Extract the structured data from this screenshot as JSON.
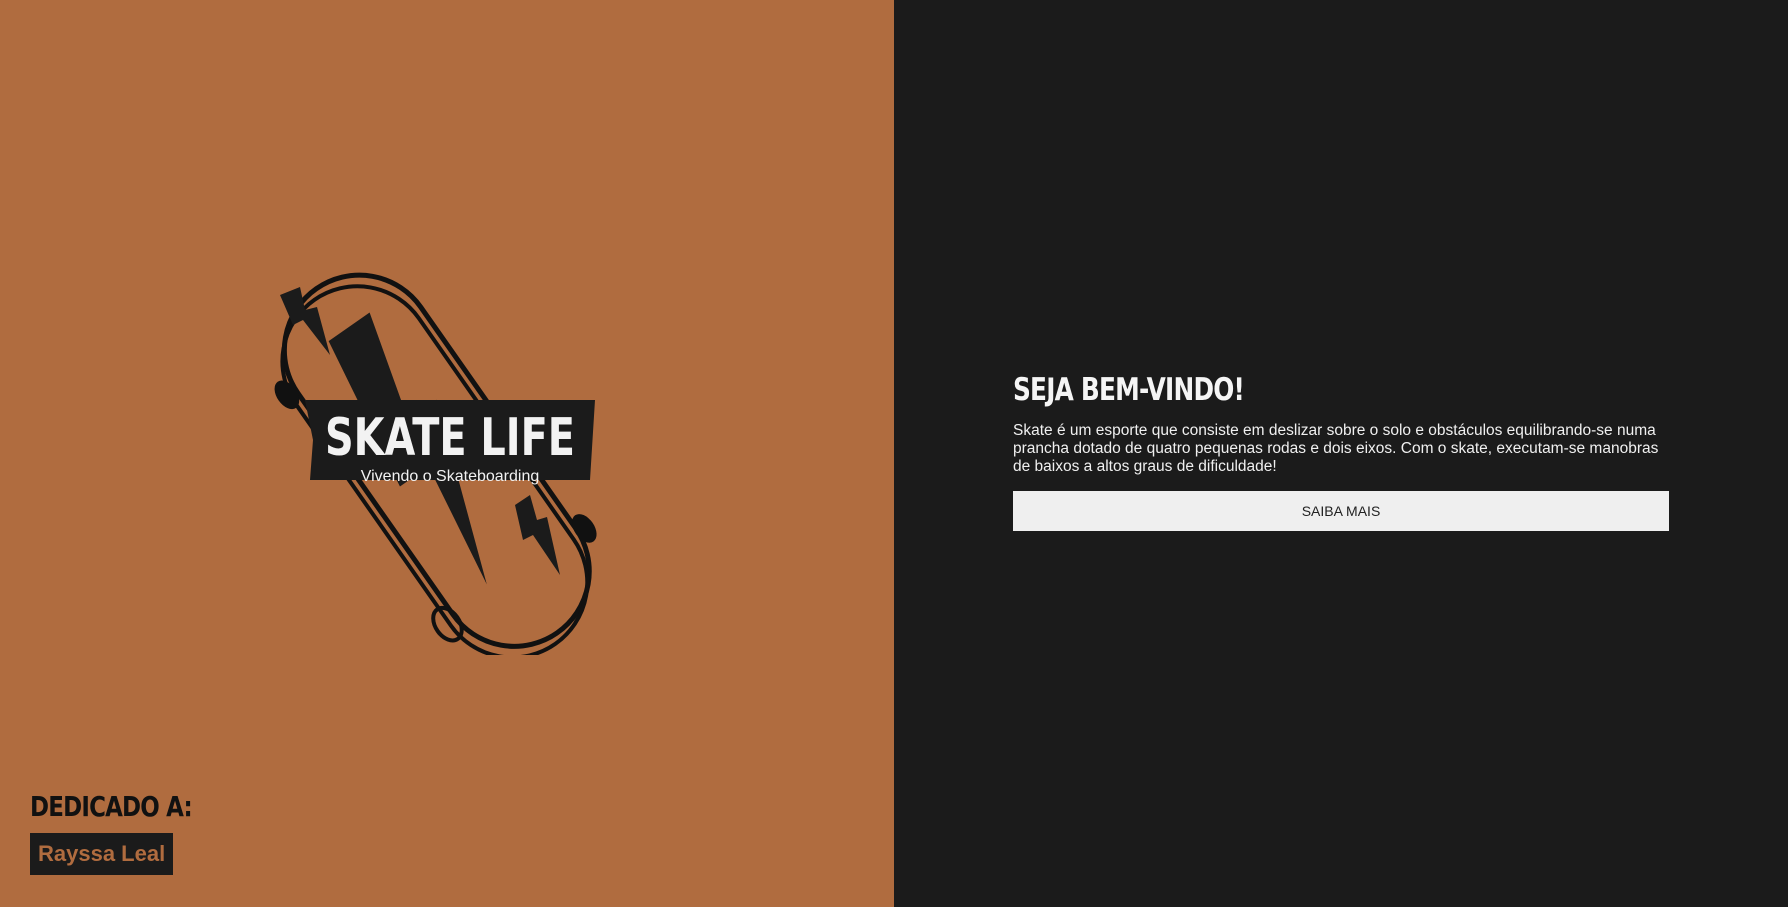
{
  "brand": {
    "title": "SKATE LIFE",
    "subtitle": "Vivendo o Skateboarding"
  },
  "dedication": {
    "heading": "DEDICADO A:",
    "name": "Rayssa Leal"
  },
  "main": {
    "heading": "SEJA BEM-VINDO!",
    "body": "Skate é um esporte que consiste em deslizar sobre o solo e obstáculos equilibrando-se numa prancha dotado de quatro pequenas rodas e dois eixos. Com o skate, executam-se manobras de baixos a altos graus de dificuldade!",
    "button_label": "SAIBA MAIS"
  },
  "colors": {
    "left_bg": "#b06c3f",
    "right_bg": "#1b1b1b",
    "button_bg": "#efefef"
  },
  "icons": [
    "skateboard-logo",
    "lightning-bolt-icon"
  ]
}
